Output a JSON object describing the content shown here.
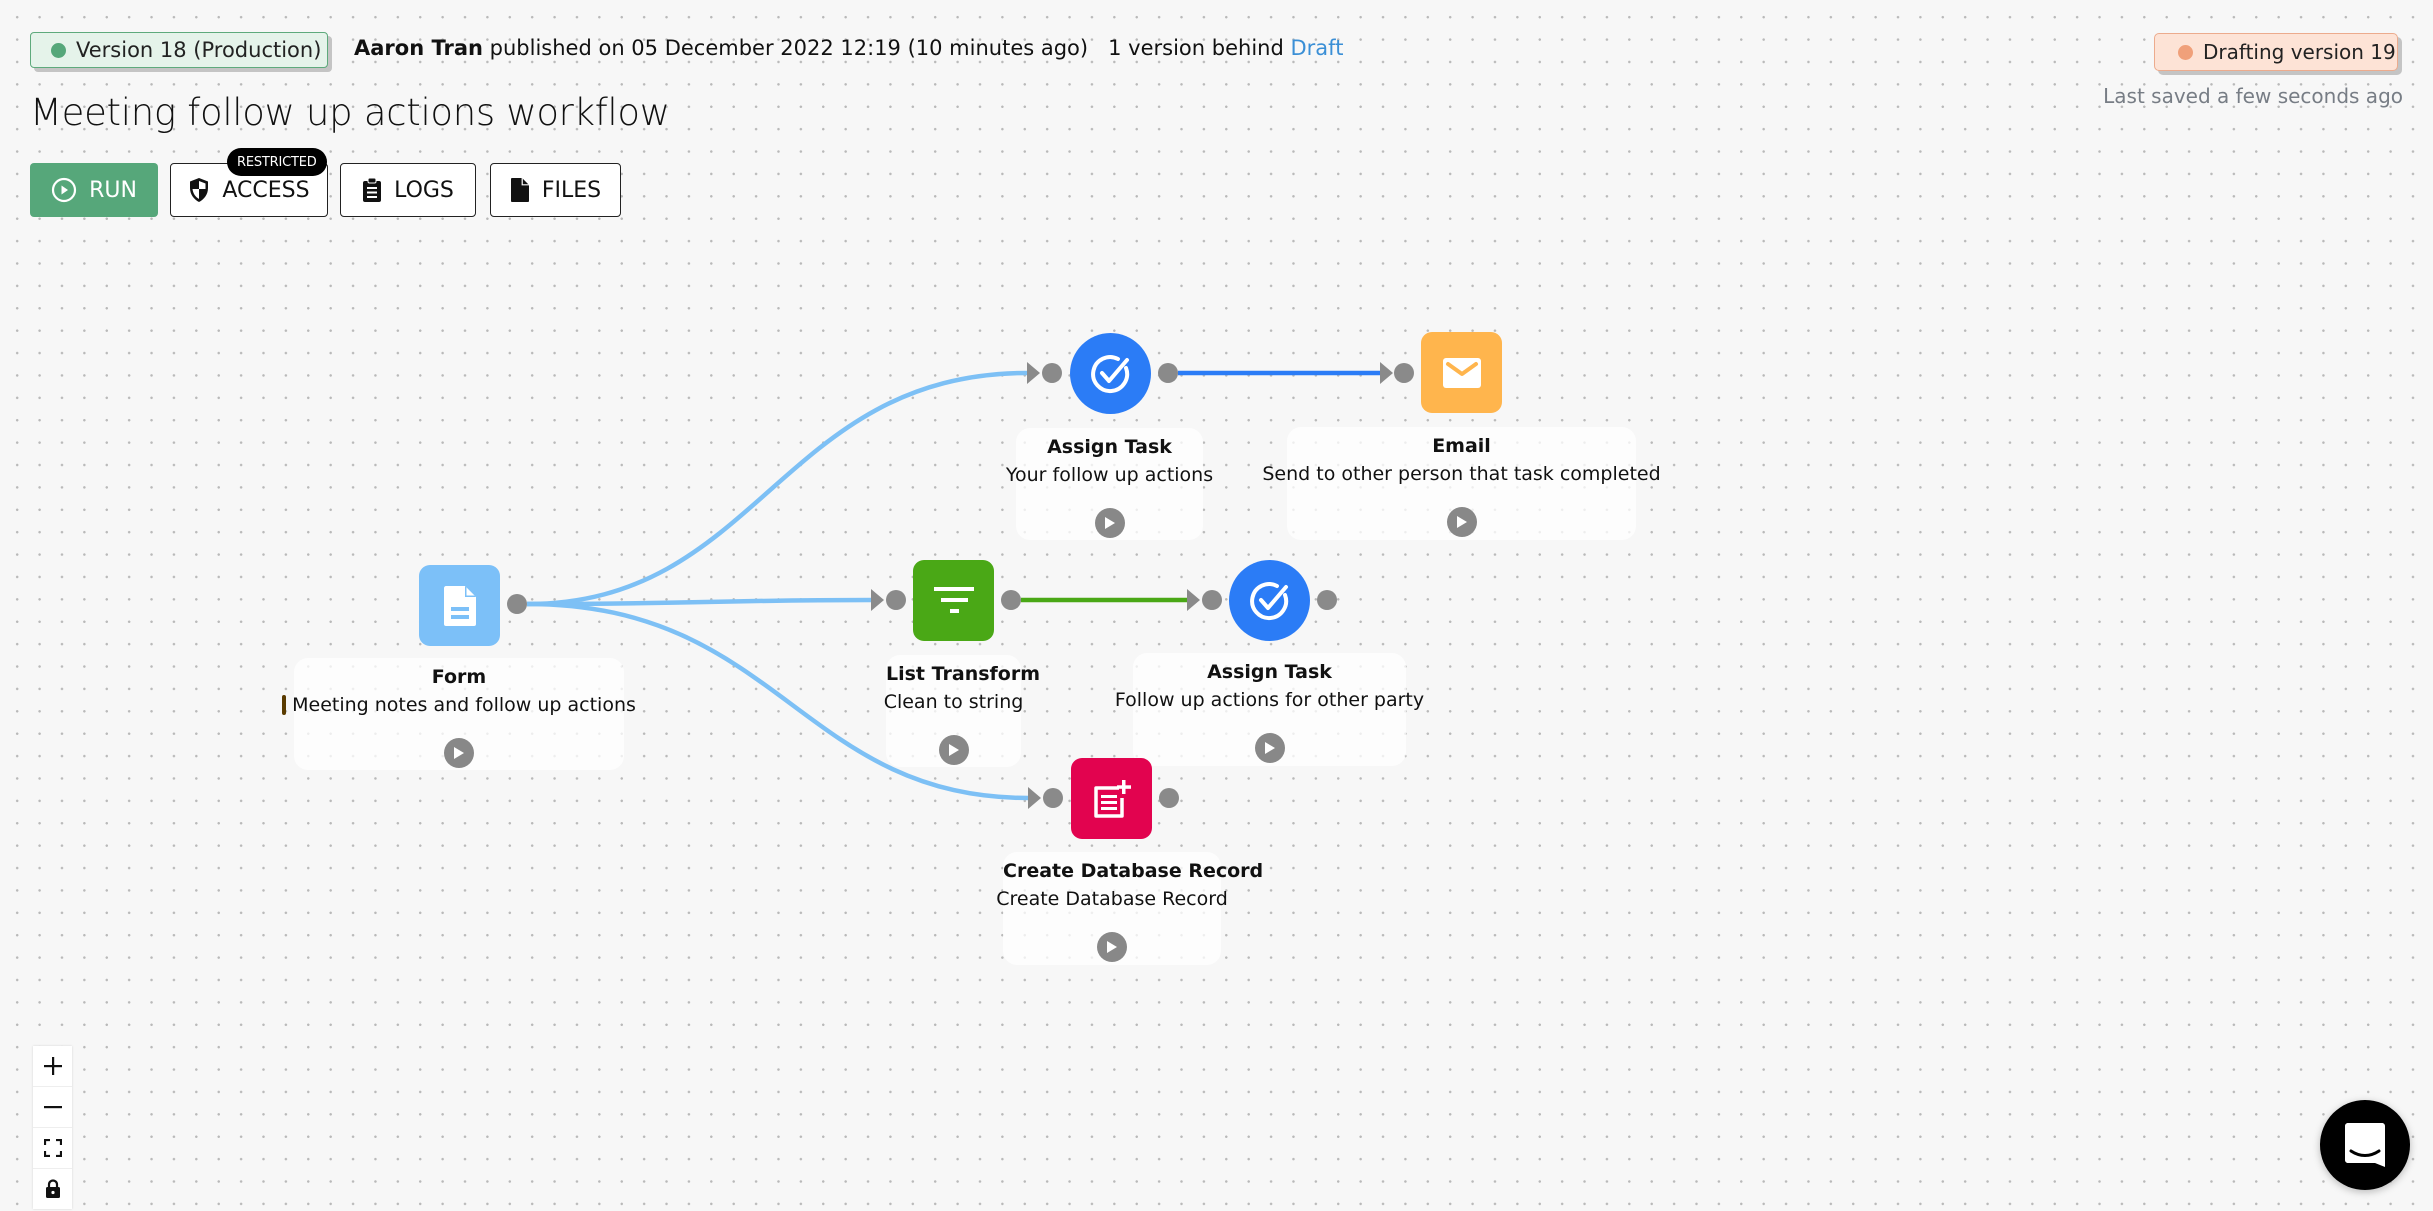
{
  "header": {
    "version_badge": {
      "label": "Version 18 (Production)",
      "color": "#56a77a"
    },
    "publisher": "Aaron Tran",
    "published_text": "published on 05 December 2022 12:19 (10 minutes ago)",
    "versions_behind_text": "1 version behind",
    "draft_link": "Draft",
    "drafting_badge": {
      "label": "Drafting version 19",
      "color": "#f0a07a"
    },
    "last_saved": "Last saved a few seconds ago",
    "title": "Meeting follow up actions workflow"
  },
  "toolbar": {
    "run_label": "RUN",
    "access_label": "ACCESS",
    "access_badge": "RESTRICTED",
    "logs_label": "LOGS",
    "files_label": "FILES"
  },
  "nodes": [
    {
      "id": "form",
      "type": "Form",
      "title": "Form",
      "subtitle": "Meeting notes and follow up actions",
      "icon": "document-icon",
      "color": "#7cc0f8",
      "shape": "square"
    },
    {
      "id": "assign1",
      "type": "Assign Task",
      "title": "Assign Task",
      "subtitle": "Your follow up actions",
      "icon": "check-circle-icon",
      "color": "#2b7cf6",
      "shape": "circle"
    },
    {
      "id": "email",
      "type": "Email",
      "title": "Email",
      "subtitle": "Send to other person that task completed",
      "icon": "envelope-icon",
      "color": "#ffb54d",
      "shape": "square"
    },
    {
      "id": "listtransform",
      "type": "List Transform",
      "title": "List Transform",
      "subtitle": "Clean to string",
      "icon": "filter-icon",
      "color": "#4aa816",
      "shape": "square"
    },
    {
      "id": "assign2",
      "type": "Assign Task",
      "title": "Assign Task",
      "subtitle": "Follow up actions for other party",
      "icon": "check-circle-icon",
      "color": "#2b7cf6",
      "shape": "circle"
    },
    {
      "id": "createdb",
      "type": "Create Database Record",
      "title": "Create Database Record",
      "subtitle": "Create Database Record",
      "icon": "add-record-icon",
      "color": "#e2034f",
      "shape": "square"
    }
  ],
  "edges": [
    {
      "from": "form",
      "to": "assign1",
      "color": "#7dc0f5"
    },
    {
      "from": "form",
      "to": "listtransform",
      "color": "#7dc0f5"
    },
    {
      "from": "form",
      "to": "createdb",
      "color": "#7dc0f5"
    },
    {
      "from": "assign1",
      "to": "email",
      "color": "#2b7cf6"
    },
    {
      "from": "listtransform",
      "to": "assign2",
      "color": "#4aa816"
    }
  ],
  "zoom_controls": [
    "zoom-in",
    "zoom-out",
    "fit-view",
    "lock"
  ]
}
